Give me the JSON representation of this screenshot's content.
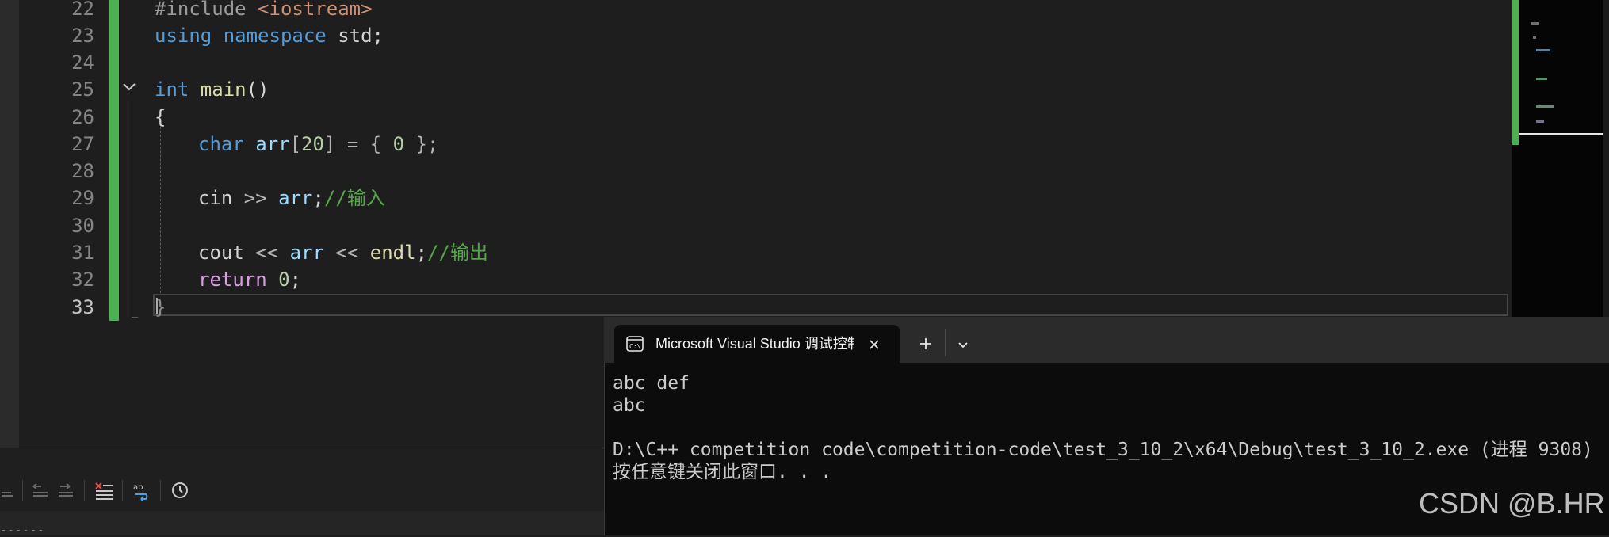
{
  "editor": {
    "line_numbers": [
      "22",
      "23",
      "24",
      "25",
      "26",
      "27",
      "28",
      "29",
      "30",
      "31",
      "32",
      "33"
    ],
    "active_line": "33",
    "code": {
      "l22_pp": "#include ",
      "l22_hdr": "<iostream>",
      "l23_kw1": "using",
      "l23_kw2": " namespace",
      "l23_rest": " std;",
      "l25_kw": "int",
      "l25_fn": " main",
      "l25_rest": "()",
      "l26": "{",
      "l27_kw": "char",
      "l27_var": " arr",
      "l27_b1": "[",
      "l27_num": "20",
      "l27_b2": "] = { ",
      "l27_num2": "0",
      "l27_end": " };",
      "l29_a": "cin ",
      "l29_op": ">>",
      "l29_var": " arr",
      "l29_semi": ";",
      "l29_cm": "//输入",
      "l31_a": "cout ",
      "l31_op1": "<<",
      "l31_var": " arr",
      "l31_op2": " <<",
      "l31_fn": " endl",
      "l31_semi": ";",
      "l31_cm": "//输出",
      "l32_kw": "return",
      "l32_num": " 0",
      "l32_semi": ";",
      "l33": "}"
    }
  },
  "console": {
    "tab_title": "Microsoft Visual Studio 调试控制台",
    "tab_icon": "terminal-icon",
    "lines": [
      "abc def",
      "abc",
      "",
      "D:\\C++ competition code\\competition-code\\test_3_10_2\\x64\\Debug\\test_3_10_2.exe (进程 9308)",
      "按任意键关闭此窗口. . ."
    ]
  },
  "output_panel": {
    "dashes": "------"
  },
  "watermark": "CSDN @B.HR",
  "colors": {
    "accent_green": "#4caf50",
    "keyword": "#569cd6",
    "function": "#dcdcaa",
    "variable": "#9cdcfe",
    "number": "#b5cea8",
    "string": "#ce9178",
    "comment": "#57a64a"
  }
}
